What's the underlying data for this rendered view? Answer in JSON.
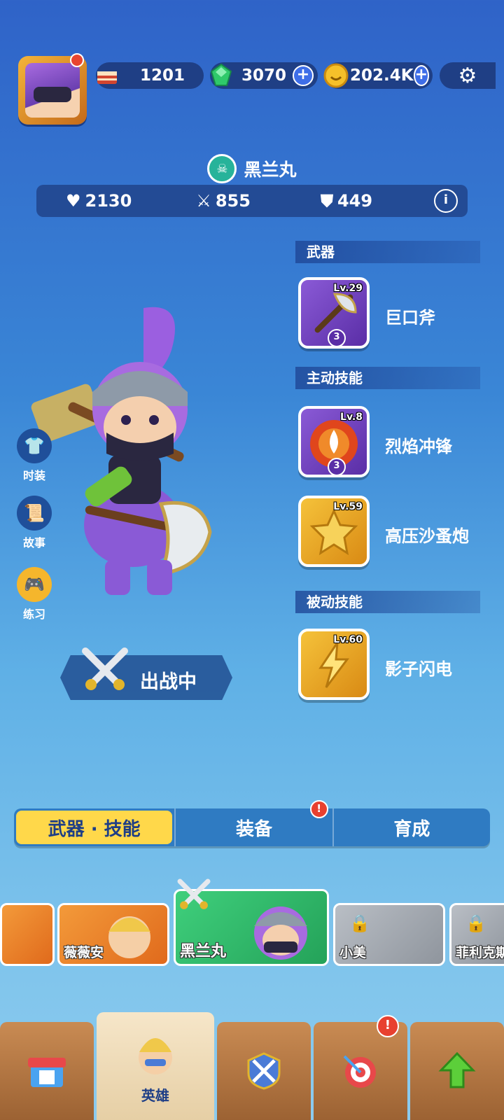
{
  "header": {
    "cake_value": "1201",
    "gem_value": "3070",
    "coin_value": "202.4K",
    "plus": "+"
  },
  "hero": {
    "name": "黑兰丸",
    "hp": "2130",
    "attack": "855",
    "defense": "449"
  },
  "side_buttons": [
    {
      "label": "时装"
    },
    {
      "label": "故事"
    },
    {
      "label": "练习"
    }
  ],
  "deploy_label": "出战中",
  "sections": {
    "weapon": "武器",
    "active": "主动技能",
    "passive": "被动技能"
  },
  "skills": [
    {
      "level": "Lv.29",
      "stars": "3",
      "name": "巨口斧"
    },
    {
      "level": "Lv.8",
      "stars": "3",
      "name": "烈焰冲锋"
    },
    {
      "level": "Lv.59",
      "name": "高压沙蚤炮"
    },
    {
      "level": "Lv.60",
      "name": "影子闪电"
    }
  ],
  "tabs": [
    {
      "label": "武器 · 技能"
    },
    {
      "label": "装备"
    },
    {
      "label": "育成"
    }
  ],
  "alert": "!",
  "hero_cards": [
    {
      "label": ""
    },
    {
      "label": "薇薇安"
    },
    {
      "label": "黑兰丸"
    },
    {
      "label": "小美"
    },
    {
      "label": "菲利克斯"
    }
  ],
  "nav": {
    "hero_label": "英雄"
  },
  "colors": {
    "accent_yellow": "#ffd84a",
    "selected_green": "#2fb36b",
    "alert_red": "#e8402f"
  }
}
